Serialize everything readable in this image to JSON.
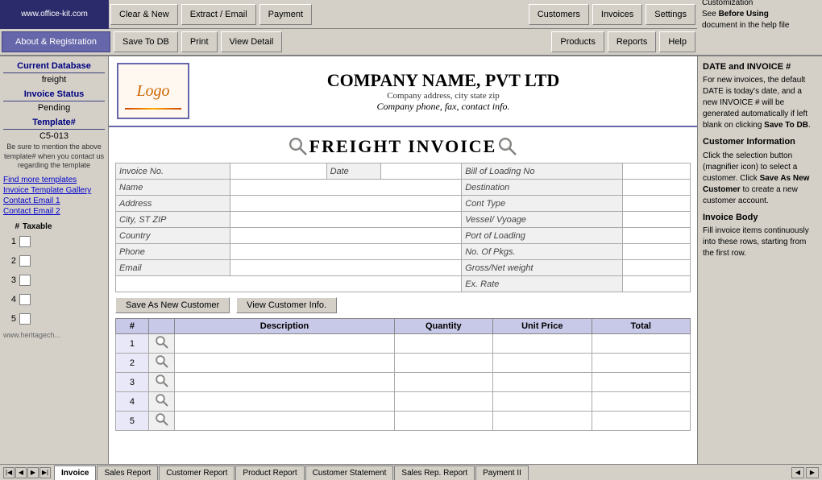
{
  "brand": {
    "url": "www.office-kit.com"
  },
  "toolbar_top": {
    "buttons": [
      "Clear & New",
      "Extract / Email",
      "Payment",
      "Customers",
      "Invoices",
      "Settings"
    ],
    "right_info": "Customization\nSee Before Using\ndocument in the help file"
  },
  "toolbar_bottom": {
    "about_label": "About & Registration",
    "buttons": [
      "Save To DB",
      "Print",
      "View Detail",
      "Products",
      "Reports",
      "Help"
    ]
  },
  "sidebar_left": {
    "current_db_label": "Current Database",
    "current_db_value": "freight",
    "invoice_status_label": "Invoice Status",
    "invoice_status_value": "Pending",
    "template_label": "Template#",
    "template_value": "C5-013",
    "template_note": "Be sure to mention the above template# when you contact us regarding the template",
    "links": [
      "Find more templates",
      "Invoice Template Gallery",
      "Contact Email 1",
      "Contact Email 2"
    ],
    "row_header_num": "#",
    "row_header_taxable": "Taxable",
    "rows": [
      1,
      2,
      3,
      4,
      5
    ]
  },
  "company": {
    "name": "COMPANY NAME,  PVT LTD",
    "address": "Company address, city state zip",
    "phone": "Company phone, fax, contact info."
  },
  "invoice": {
    "title": "FREIGHT INVOICE",
    "fields_left": [
      {
        "label": "Invoice No.",
        "value": ""
      },
      {
        "label": "Name",
        "value": ""
      },
      {
        "label": "Address",
        "value": ""
      },
      {
        "label": "City, ST ZIP",
        "value": ""
      },
      {
        "label": "Country",
        "value": ""
      },
      {
        "label": "Phone",
        "value": ""
      },
      {
        "label": "Email",
        "value": ""
      }
    ],
    "date_label": "Date",
    "fields_right": [
      {
        "label": "Bill of Loading No",
        "value": ""
      },
      {
        "label": "Destination",
        "value": ""
      },
      {
        "label": "Cont Type",
        "value": ""
      },
      {
        "label": "Vessel/ Vyoage",
        "value": ""
      },
      {
        "label": "Port of Loading",
        "value": ""
      },
      {
        "label": "No. Of Pkgs.",
        "value": ""
      },
      {
        "label": "Gross/Net weight",
        "value": ""
      },
      {
        "label": "Ex. Rate",
        "value": ""
      }
    ],
    "btn_save_customer": "Save As New Customer",
    "btn_view_customer": "View Customer Info.",
    "table_headers": [
      "#",
      "Description",
      "Quantity",
      "Unit Price",
      "Total"
    ],
    "line_items": [
      {
        "num": 1
      },
      {
        "num": 2
      },
      {
        "num": 3
      },
      {
        "num": 4
      },
      {
        "num": 5
      }
    ]
  },
  "right_sidebar": {
    "sections": [
      {
        "title": "DATE and INVOICE #",
        "text": "For new invoices, the default DATE is today's date, and a new INVOICE # will be generated automatically if left blank on clicking ",
        "highlight": "Save To DB",
        "text2": "."
      },
      {
        "title": "Customer Information",
        "text": "Click the selection button (magnifier icon) to select a customer. Click ",
        "highlight": "Save As New Customer",
        "text2": " to create a new customer account."
      },
      {
        "title": "Invoice Body",
        "text": "Fill invoice items continuously into these rows, starting from the first row."
      }
    ]
  },
  "tabs": {
    "items": [
      "Invoice",
      "Sales Report",
      "Customer Report",
      "Product Report",
      "Customer Statement",
      "Sales Rep. Report",
      "Payment II"
    ]
  }
}
